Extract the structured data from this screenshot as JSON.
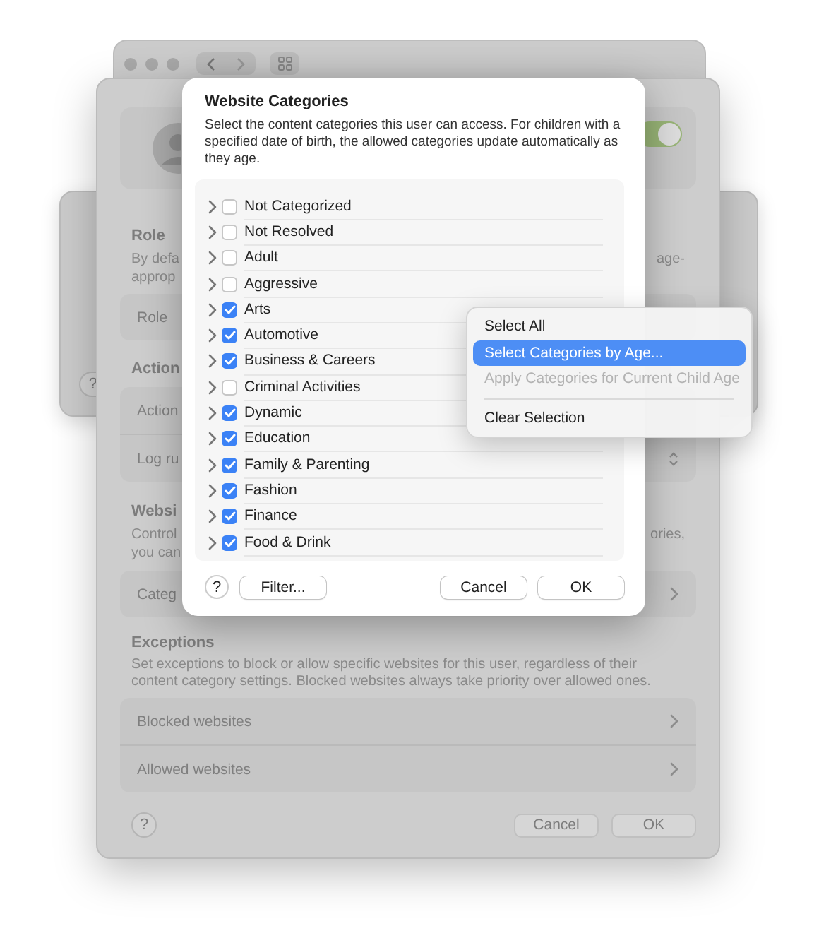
{
  "side_window": {
    "help_button": "?"
  },
  "settings_window": {
    "toggle": {
      "on": true
    },
    "role_section": {
      "heading": "Role",
      "description_lines": [
        {
          "left": "By defa",
          "right": "age-"
        },
        {
          "left": "approp"
        }
      ],
      "rows": [
        "Role"
      ]
    },
    "actions_section": {
      "heading": "Action",
      "rows": [
        "Action",
        "Log ru"
      ]
    },
    "websites_section": {
      "heading": "Websi",
      "description_lines": [
        {
          "left": "Control",
          "right": "ories,"
        },
        {
          "left": "you can"
        }
      ],
      "rows": [
        "Categ"
      ]
    },
    "exceptions_section": {
      "heading": "Exceptions",
      "description": "Set exceptions to block or allow specific websites for this user, regardless of their content category settings. Blocked websites always take priority over allowed ones.",
      "rows": [
        "Blocked websites",
        "Allowed websites"
      ]
    },
    "footer": {
      "help_button": "?",
      "buttons": [
        "Cancel",
        "OK"
      ]
    }
  },
  "dialog": {
    "title": "Website Categories",
    "description": "Select the content categories this user can access. For children with a specified date of birth, the allowed categories update automatically as they age.",
    "categories": [
      {
        "label": "Not Categorized",
        "checked": false
      },
      {
        "label": "Not Resolved",
        "checked": false
      },
      {
        "label": "Adult",
        "checked": false
      },
      {
        "label": "Aggressive",
        "checked": false
      },
      {
        "label": "Arts",
        "checked": true
      },
      {
        "label": "Automotive",
        "checked": true
      },
      {
        "label": "Business & Careers",
        "checked": true
      },
      {
        "label": "Criminal Activities",
        "checked": false
      },
      {
        "label": "Dynamic",
        "checked": true
      },
      {
        "label": "Education",
        "checked": true
      },
      {
        "label": "Family & Parenting",
        "checked": true
      },
      {
        "label": "Fashion",
        "checked": true
      },
      {
        "label": "Finance",
        "checked": true
      },
      {
        "label": "Food & Drink",
        "checked": true
      }
    ],
    "help_button": "?",
    "filter_button": "Filter...",
    "buttons": [
      "Cancel",
      "OK"
    ]
  },
  "context_menu": {
    "items": [
      {
        "kind": "item",
        "label": "Select All",
        "selected": false,
        "disabled": false
      },
      {
        "kind": "item",
        "label": "Select Categories by Age...",
        "selected": true,
        "disabled": false
      },
      {
        "kind": "item",
        "label": "Apply Categories for Current Child Age",
        "selected": false,
        "disabled": true
      },
      {
        "kind": "separator"
      },
      {
        "kind": "item",
        "label": "Clear Selection",
        "selected": false,
        "disabled": false
      }
    ]
  }
}
